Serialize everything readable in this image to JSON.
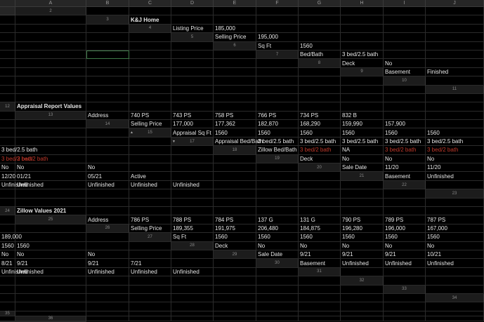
{
  "columns": [
    "A",
    "B",
    "C",
    "D",
    "E",
    "F",
    "G",
    "H",
    "I",
    "J"
  ],
  "rows": [
    {
      "num": "2",
      "cells": [
        "",
        "",
        "",
        "",
        "",
        "",
        "",
        "",
        "",
        ""
      ]
    },
    {
      "num": "3",
      "cells": [
        "K&J Home",
        "",
        "",
        "",
        "",
        "",
        "",
        "",
        "",
        ""
      ],
      "bold": true
    },
    {
      "num": "4",
      "cells": [
        "Listing Price",
        "185,000",
        "",
        "",
        "",
        "",
        "",
        "",
        "",
        ""
      ]
    },
    {
      "num": "5",
      "cells": [
        "Selling Price",
        "195,000",
        "",
        "",
        "",
        "",
        "",
        "",
        "",
        ""
      ]
    },
    {
      "num": "6",
      "cells": [
        "Sq Ft",
        "1560",
        "",
        "",
        "",
        "",
        "",
        "",
        "",
        ""
      ]
    },
    {
      "num": "7",
      "cells": [
        "Bed/Bath",
        "3 bed/2.5 bath",
        "",
        "",
        "",
        "",
        "",
        "",
        "",
        ""
      ]
    },
    {
      "num": "8",
      "cells": [
        "Deck",
        "No",
        "",
        "",
        "",
        "",
        "",
        "",
        "",
        ""
      ]
    },
    {
      "num": "9",
      "cells": [
        "Basement",
        "Finished",
        "",
        "",
        "",
        "",
        "",
        "",
        "",
        ""
      ]
    },
    {
      "num": "10",
      "cells": [
        "",
        "",
        "",
        "",
        "",
        "",
        "",
        "",
        "",
        ""
      ]
    },
    {
      "num": "11",
      "cells": [
        "",
        "",
        "",
        "",
        "",
        "",
        "",
        "",
        "",
        ""
      ]
    },
    {
      "num": "12",
      "cells": [
        "Appraisal Report Values",
        "",
        "",
        "",
        "",
        "",
        "",
        "",
        "",
        ""
      ],
      "bold": true
    },
    {
      "num": "13",
      "cells": [
        "Address",
        "740 PS",
        "743 PS",
        "758 PS",
        "766 PS",
        "734 PS",
        "832 B",
        "",
        "",
        ""
      ]
    },
    {
      "num": "14",
      "cells": [
        "Selling Price",
        "177,000",
        "177,362",
        "182,870",
        "168,290",
        "159,990",
        "157,900",
        "",
        "",
        ""
      ]
    },
    {
      "num": "15",
      "cells": [
        "Appraisal Sq Ft",
        "1560",
        "1560",
        "1560",
        "1560",
        "1560",
        "1560",
        "",
        "",
        ""
      ]
    },
    {
      "num": "17",
      "cells": [
        "Appraisal Bed/Bath",
        "3 bed/2.5 bath",
        "3 bed/2.5 bath",
        "3 bed/2.5 bath",
        "3 bed/2.5 bath",
        "3 bed/2.5 bath",
        "3 bed/2.5 bath",
        "",
        "",
        ""
      ]
    },
    {
      "num": "18",
      "cells": [
        "Zillow Bed/Bath",
        "3 bed/2 bath",
        "NA",
        "3 bed/2 bath",
        "3 bed/2 bath",
        "3 bed/2 bath",
        "3 bed/2 bath",
        "",
        "",
        ""
      ],
      "red": [
        1,
        3,
        4,
        5,
        6
      ]
    },
    {
      "num": "19",
      "cells": [
        "Deck",
        "No",
        "No",
        "No",
        "No",
        "No",
        "No",
        "",
        "",
        ""
      ]
    },
    {
      "num": "20",
      "cells": [
        "Sale Date",
        "11/20",
        "11/20",
        "12/20",
        "01/21",
        "05/21",
        "Active",
        "",
        "",
        ""
      ]
    },
    {
      "num": "21",
      "cells": [
        "Basement",
        "Unfinished",
        "Unfinished",
        "Unfinished",
        "Unfinished",
        "Unfinished",
        "Unfinished",
        "",
        "",
        ""
      ]
    },
    {
      "num": "22",
      "cells": [
        "",
        "",
        "",
        "",
        "",
        "",
        "",
        "",
        "",
        ""
      ]
    },
    {
      "num": "23",
      "cells": [
        "",
        "",
        "",
        "",
        "",
        "",
        "",
        "",
        "",
        ""
      ]
    },
    {
      "num": "24",
      "cells": [
        "Zillow Values 2021",
        "",
        "",
        "",
        "",
        "",
        "",
        "",
        "",
        ""
      ],
      "bold": true
    },
    {
      "num": "25",
      "cells": [
        "Address",
        "786 PS",
        "788 PS",
        "784 PS",
        "137 G",
        "131 G",
        "790 PS",
        "789 PS",
        "787 PS",
        ""
      ]
    },
    {
      "num": "26",
      "cells": [
        "Selling Price",
        "189,355",
        "191,975",
        "206,480",
        "184,875",
        "196,280",
        "196,000",
        "167,000",
        "189,000",
        ""
      ]
    },
    {
      "num": "27",
      "cells": [
        "Sq Ft",
        "1560",
        "1560",
        "1560",
        "1560",
        "1560",
        "1560",
        "1560",
        "1560",
        ""
      ]
    },
    {
      "num": "28",
      "cells": [
        "Deck",
        "No",
        "No",
        "No",
        "No",
        "No",
        "No",
        "No",
        "No",
        ""
      ]
    },
    {
      "num": "29",
      "cells": [
        "Sale Date",
        "9/21",
        "9/21",
        "9/21",
        "10/21",
        "8/21",
        "9/21",
        "9/21",
        "7/21",
        ""
      ]
    },
    {
      "num": "30",
      "cells": [
        "Basement",
        "Unfinished",
        "Unfinished",
        "Unfinished",
        "Unfinished",
        "Unfinished",
        "Unfinished",
        "Unfinished",
        "Unfinished",
        ""
      ]
    },
    {
      "num": "31",
      "cells": [
        "",
        "",
        "",
        "",
        "",
        "",
        "",
        "",
        "",
        ""
      ]
    },
    {
      "num": "32",
      "cells": [
        "",
        "",
        "",
        "",
        "",
        "",
        "",
        "",
        "",
        ""
      ]
    },
    {
      "num": "33",
      "cells": [
        "",
        "",
        "",
        "",
        "",
        "",
        "",
        "",
        "",
        ""
      ]
    },
    {
      "num": "34",
      "cells": [
        "",
        "",
        "",
        "",
        "",
        "",
        "",
        "",
        "",
        ""
      ]
    },
    {
      "num": "35",
      "cells": [
        "",
        "",
        "",
        "",
        "",
        "",
        "",
        "",
        "",
        ""
      ]
    },
    {
      "num": "36",
      "cells": [
        "",
        "",
        "",
        "",
        "",
        "",
        "",
        "",
        "",
        ""
      ]
    }
  ]
}
